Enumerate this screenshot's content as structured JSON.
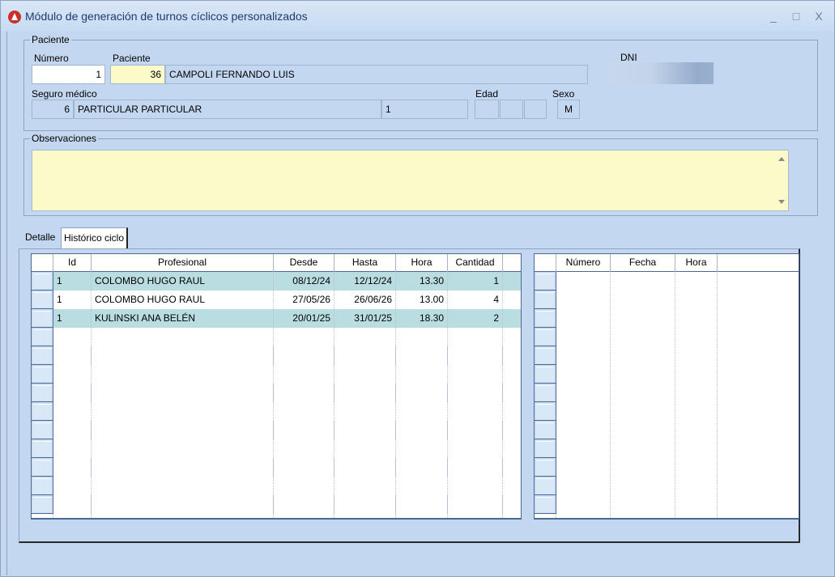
{
  "window": {
    "title": "Módulo de generación de turnos cíclicos personalizados",
    "buttons": {
      "minimize": "_",
      "maximize": "□",
      "close": "X"
    }
  },
  "paciente": {
    "group_label": "Paciente",
    "numero_label": "Número",
    "numero_value": "1",
    "paciente_label": "Paciente",
    "paciente_id": "36",
    "paciente_nombre": "CAMPOLI FERNANDO LUIS",
    "dni_label": "DNI",
    "seguro_label": "Seguro médico",
    "seguro_id": "6",
    "seguro_nombre": "PARTICULAR PARTICULAR",
    "seguro_plan": "1",
    "edad_label": "Edad",
    "sexo_label": "Sexo",
    "sexo_value": "M"
  },
  "observaciones": {
    "group_label": "Observaciones",
    "value": ""
  },
  "tabs": [
    {
      "label": "Detalle",
      "active": false
    },
    {
      "label": "Histórico ciclo",
      "active": true
    }
  ],
  "historico_table": {
    "columns": [
      "Id",
      "Profesional",
      "Desde",
      "Hasta",
      "Hora",
      "Cantidad"
    ],
    "rows": [
      {
        "id": "1",
        "profesional": "COLOMBO HUGO RAUL",
        "desde": "08/12/24",
        "hasta": "12/12/24",
        "hora": "13.30",
        "cantidad": "1",
        "highlighted": true
      },
      {
        "id": "1",
        "profesional": "COLOMBO HUGO RAUL",
        "desde": "27/05/26",
        "hasta": "26/06/26",
        "hora": "13.00",
        "cantidad": "4",
        "highlighted": false
      },
      {
        "id": "1",
        "profesional": "KULINSKI ANA BELÉN",
        "desde": "20/01/25",
        "hasta": "31/01/25",
        "hora": "18.30",
        "cantidad": "2",
        "highlighted": true
      }
    ]
  },
  "turnos_table": {
    "columns": [
      "Número",
      "Fecha",
      "Hora"
    ],
    "rows": []
  },
  "colors": {
    "background": "#c3d8f0",
    "row_highlight": "#b9dde0",
    "yellow_field": "#fbfac8"
  }
}
